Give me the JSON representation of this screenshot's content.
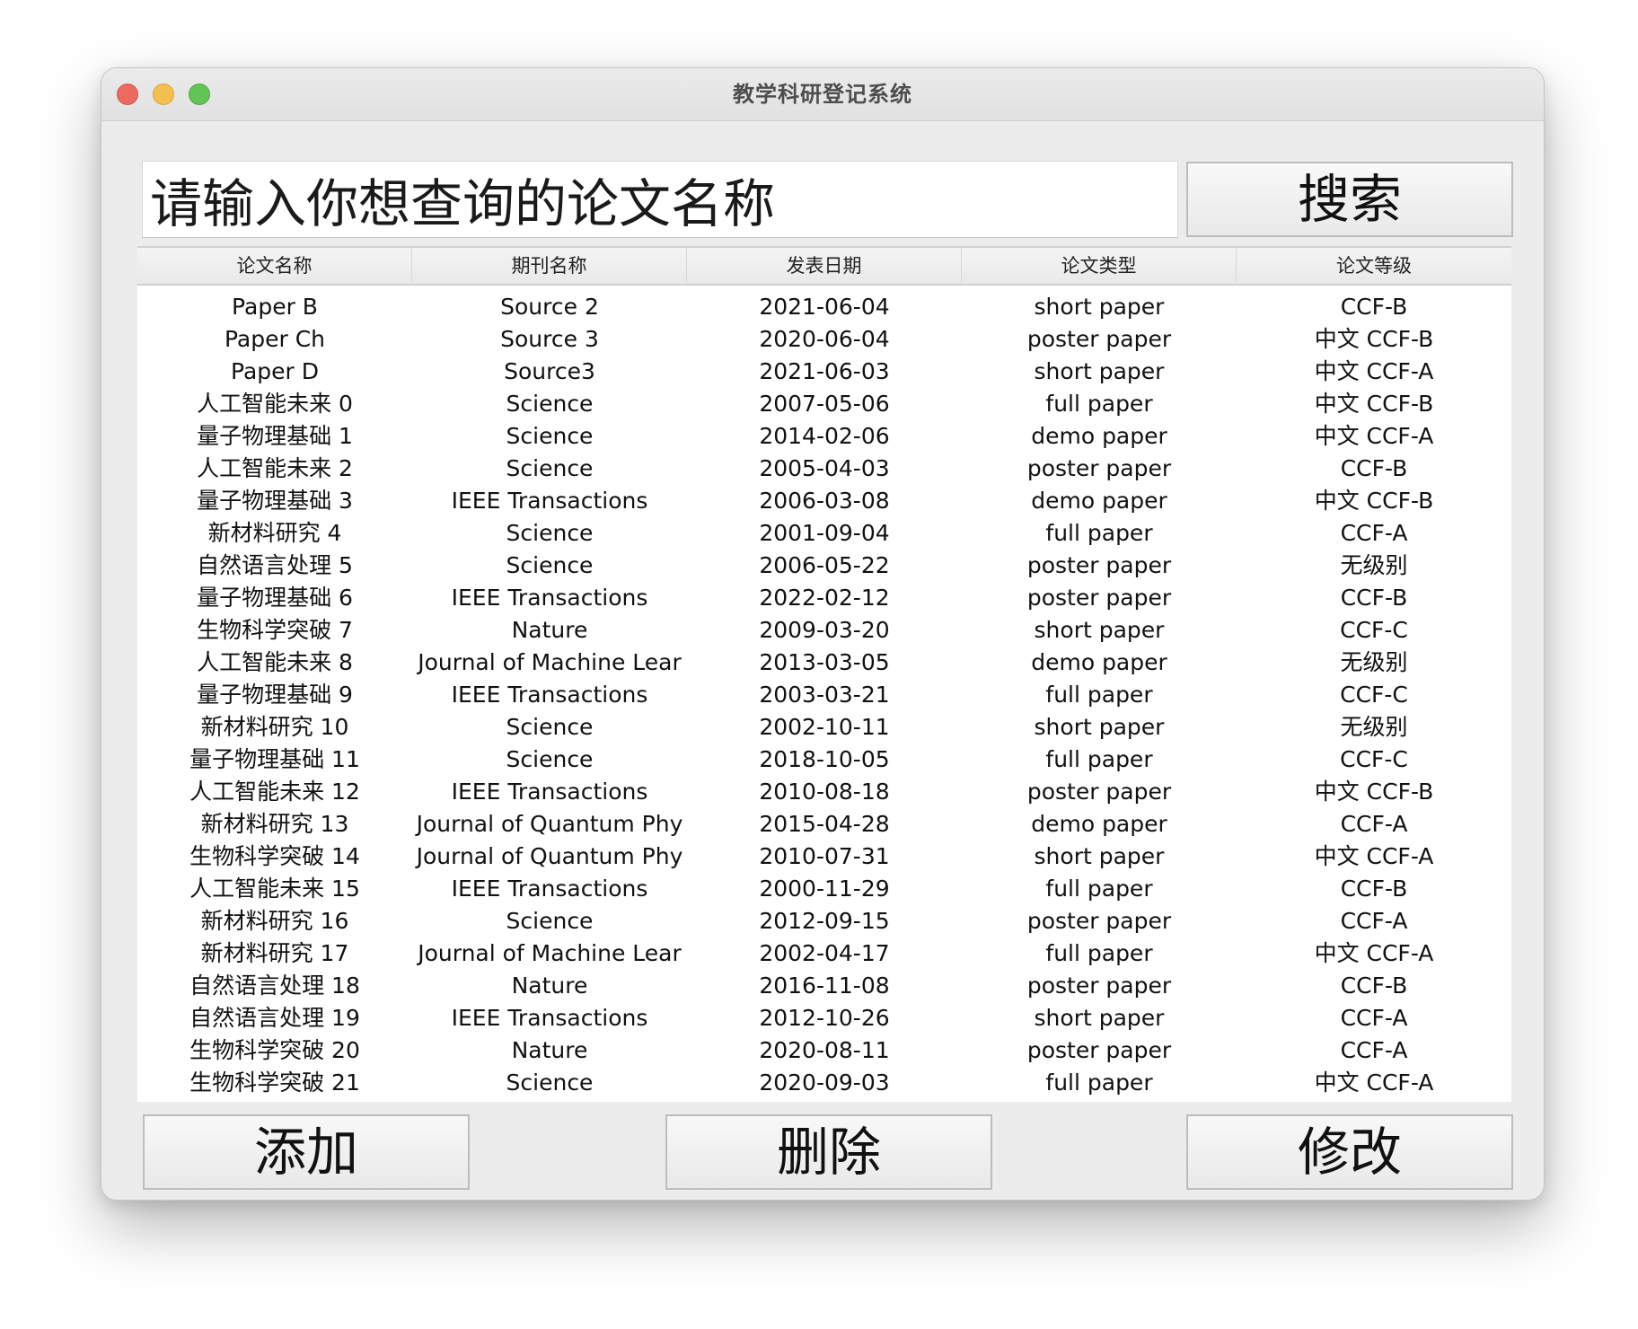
{
  "window": {
    "title": "教学科研登记系统"
  },
  "search": {
    "value": "请输入你想查询的论文名称",
    "button_label": "搜索"
  },
  "table": {
    "columns": [
      "论文名称",
      "期刊名称",
      "发表日期",
      "论文类型",
      "论文等级"
    ],
    "rows": [
      [
        "Paper B",
        "Source 2",
        "2021-06-04",
        "short paper",
        "CCF-B"
      ],
      [
        "Paper Ch",
        "Source 3",
        "2020-06-04",
        "poster paper",
        "中文 CCF-B"
      ],
      [
        "Paper D",
        "Source3",
        "2021-06-03",
        "short paper",
        "中文 CCF-A"
      ],
      [
        "人工智能未来 0",
        "Science",
        "2007-05-06",
        "full paper",
        "中文 CCF-B"
      ],
      [
        "量子物理基础 1",
        "Science",
        "2014-02-06",
        "demo paper",
        "中文 CCF-A"
      ],
      [
        "人工智能未来 2",
        "Science",
        "2005-04-03",
        "poster paper",
        "CCF-B"
      ],
      [
        "量子物理基础 3",
        "IEEE Transactions",
        "2006-03-08",
        "demo paper",
        "中文 CCF-B"
      ],
      [
        "新材料研究 4",
        "Science",
        "2001-09-04",
        "full paper",
        "CCF-A"
      ],
      [
        "自然语言处理 5",
        "Science",
        "2006-05-22",
        "poster paper",
        "无级别"
      ],
      [
        "量子物理基础 6",
        "IEEE Transactions",
        "2022-02-12",
        "poster paper",
        "CCF-B"
      ],
      [
        "生物科学突破 7",
        "Nature",
        "2009-03-20",
        "short paper",
        "CCF-C"
      ],
      [
        "人工智能未来 8",
        "Journal of Machine Lear",
        "2013-03-05",
        "demo paper",
        "无级别"
      ],
      [
        "量子物理基础 9",
        "IEEE Transactions",
        "2003-03-21",
        "full paper",
        "CCF-C"
      ],
      [
        "新材料研究 10",
        "Science",
        "2002-10-11",
        "short paper",
        "无级别"
      ],
      [
        "量子物理基础 11",
        "Science",
        "2018-10-05",
        "full paper",
        "CCF-C"
      ],
      [
        "人工智能未来 12",
        "IEEE Transactions",
        "2010-08-18",
        "poster paper",
        "中文 CCF-B"
      ],
      [
        "新材料研究 13",
        "Journal of Quantum Phy",
        "2015-04-28",
        "demo paper",
        "CCF-A"
      ],
      [
        "生物科学突破 14",
        "Journal of Quantum Phy",
        "2010-07-31",
        "short paper",
        "中文 CCF-A"
      ],
      [
        "人工智能未来 15",
        "IEEE Transactions",
        "2000-11-29",
        "full paper",
        "CCF-B"
      ],
      [
        "新材料研究 16",
        "Science",
        "2012-09-15",
        "poster paper",
        "CCF-A"
      ],
      [
        "新材料研究 17",
        "Journal of Machine Lear",
        "2002-04-17",
        "full paper",
        "中文 CCF-A"
      ],
      [
        "自然语言处理 18",
        "Nature",
        "2016-11-08",
        "poster paper",
        "CCF-B"
      ],
      [
        "自然语言处理 19",
        "IEEE Transactions",
        "2012-10-26",
        "short paper",
        "CCF-A"
      ],
      [
        "生物科学突破 20",
        "Nature",
        "2020-08-11",
        "poster paper",
        "CCF-A"
      ],
      [
        "生物科学突破 21",
        "Science",
        "2020-09-03",
        "full paper",
        "中文 CCF-A"
      ]
    ]
  },
  "actions": {
    "add_label": "添加",
    "delete_label": "删除",
    "edit_label": "修改"
  },
  "colors": {
    "close": "#ed6a5e",
    "minimize": "#f5bf4f",
    "maximize": "#61c454",
    "window_bg": "#ececec"
  }
}
